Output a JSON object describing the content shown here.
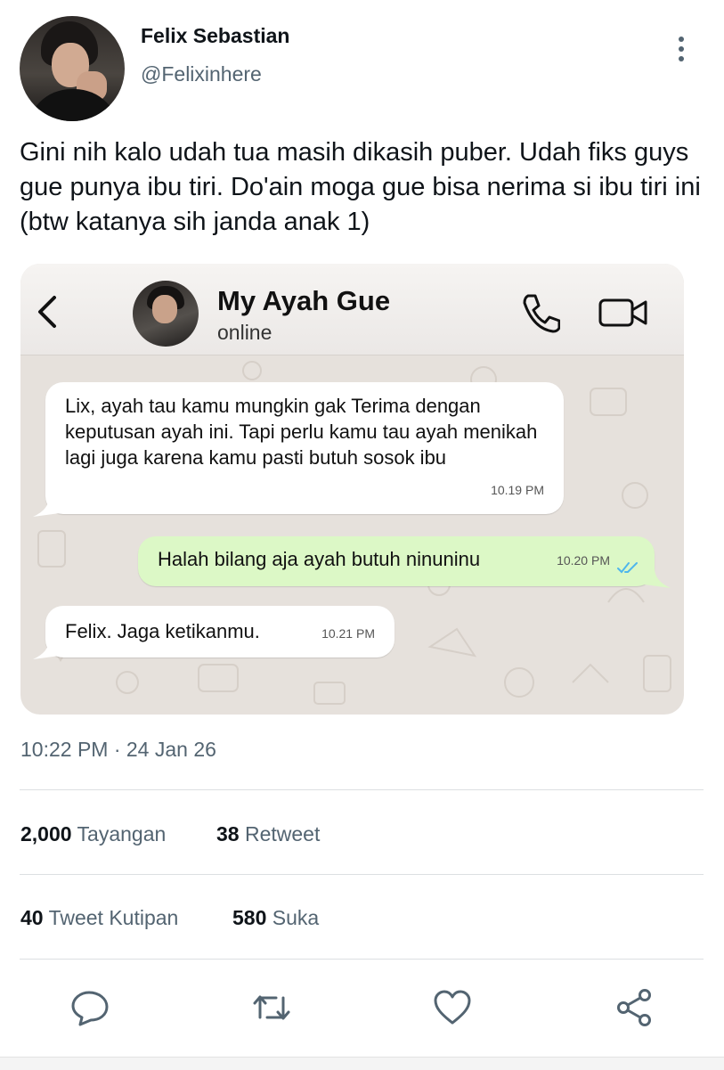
{
  "author": {
    "name": "Felix Sebastian",
    "handle": "@Felixinhere"
  },
  "tweet": {
    "text": "Gini nih kalo udah tua masih dikasih puber. Udah fiks guys gue punya ibu tiri. Do'ain moga gue bisa nerima si ibu tiri ini (btw katanya sih janda anak 1)",
    "timestamp": "10:22 PM · 24 Jan 26"
  },
  "chat": {
    "contact_name": "My Ayah Gue",
    "status": "online",
    "messages": [
      {
        "direction": "incoming",
        "text": "Lix, ayah tau kamu mungkin gak Terima dengan keputusan ayah ini. Tapi perlu kamu tau ayah menikah lagi juga karena kamu pasti butuh sosok ibu",
        "time": "10.19 PM"
      },
      {
        "direction": "outgoing",
        "text": "Halah bilang aja ayah butuh ninuninu",
        "time": "10.20 PM",
        "read": true
      },
      {
        "direction": "incoming",
        "text": "Felix. Jaga ketikanmu.",
        "time": "10.21 PM"
      }
    ],
    "colors": {
      "outgoing_bubble": "#dcf8c6",
      "incoming_bubble": "#ffffff",
      "read_check": "#4fb6ec"
    }
  },
  "stats": {
    "views_count": "2,000",
    "views_label": "Tayangan",
    "retweets_count": "38",
    "retweets_label": "Retweet",
    "quotes_count": "40",
    "quotes_label": "Tweet Kutipan",
    "likes_count": "580",
    "likes_label": "Suka"
  },
  "actions": [
    "reply-icon",
    "retweet-icon",
    "like-icon",
    "share-icon"
  ],
  "colors": {
    "secondary_text": "#536471",
    "primary_text": "#0f1419"
  }
}
